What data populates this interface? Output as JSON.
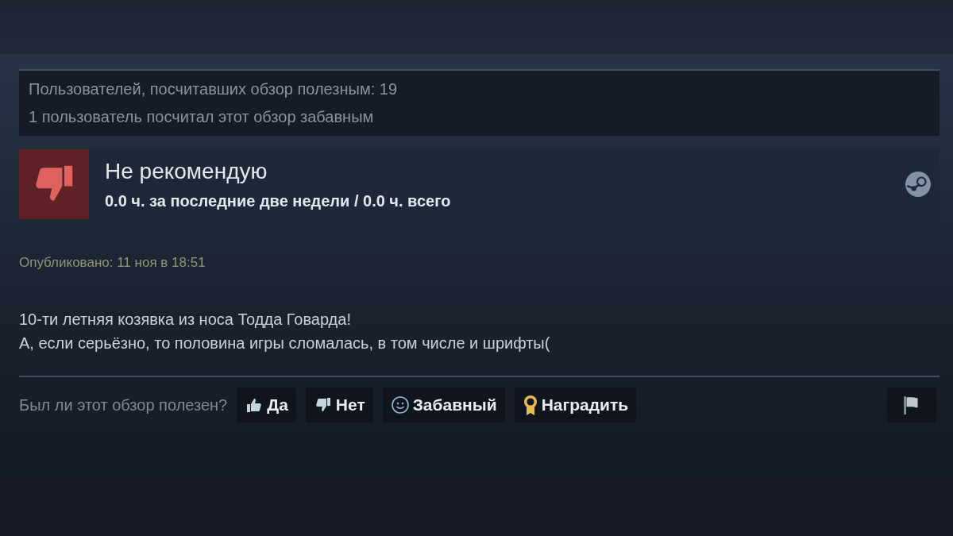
{
  "stats": [
    "Пользователей, посчитавших обзор полезным: 19",
    "1 пользователь посчитал этот обзор забавным"
  ],
  "verdict": {
    "title": "Не рекомендую",
    "hours": "0.0 ч. за последние две недели / 0.0 ч. всего"
  },
  "posted": "Опубликовано: 11 ноя в 18:51",
  "review": [
    "10-ти летняя козявка из носа Тодда Говарда!",
    "А, если серьёзно, то половина игры сломалась, в том числе и шрифты("
  ],
  "vote_prompt": "Был ли этот обзор полезен?",
  "vote_buttons": [
    {
      "kind": "yes",
      "label": "Да"
    },
    {
      "kind": "no",
      "label": "Нет"
    },
    {
      "kind": "funny",
      "label": "Забавный"
    },
    {
      "kind": "award",
      "label": "Наградить"
    }
  ]
}
